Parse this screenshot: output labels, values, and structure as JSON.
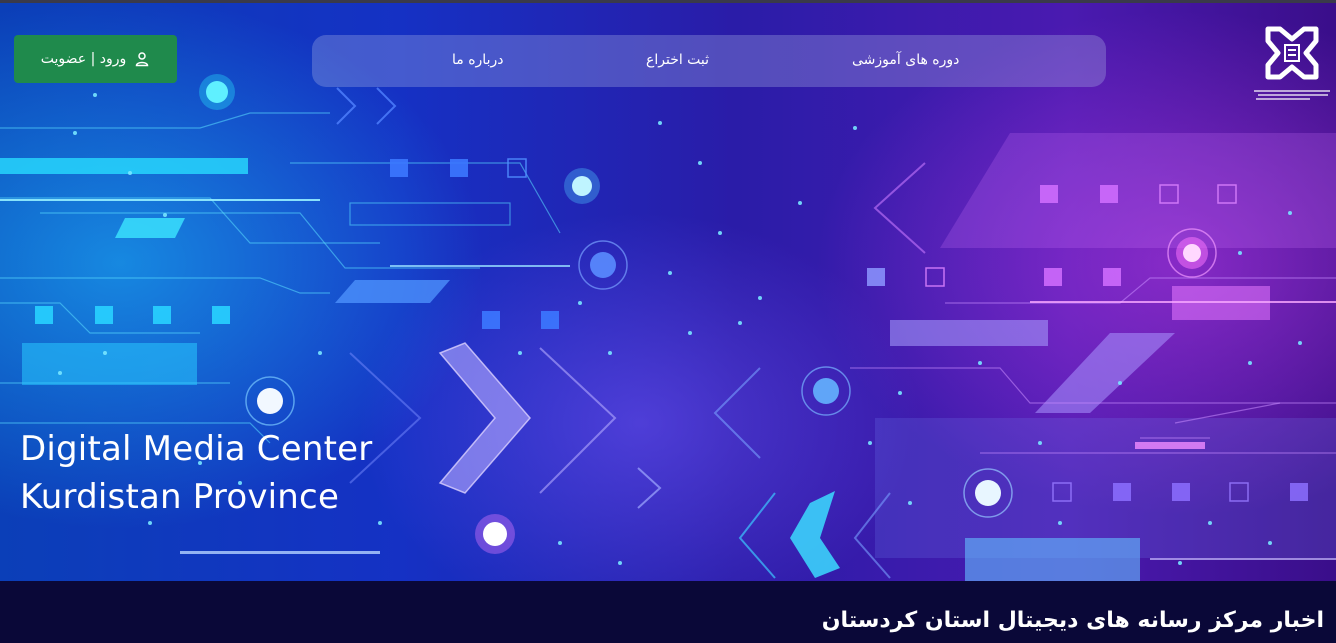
{
  "nav": {
    "items": [
      {
        "label": "دوره های آموزشی"
      },
      {
        "label": "ثبت اختراع"
      },
      {
        "label": "درباره ما"
      }
    ]
  },
  "login": {
    "label": "ورود | عضویت",
    "icon": "user-icon"
  },
  "logo": {
    "caption": "مرکز رسانه های دیجیتال استان کردستان",
    "icon": "center-logo-icon"
  },
  "hero": {
    "title_line1": "Digital Media Center",
    "title_line2": "Kurdistan Province"
  },
  "news": {
    "title": "اخبار مرکز رسانه های دیجیتال استان کردستان"
  },
  "colors": {
    "login_button": "#1f8a4c",
    "news_bar": "#0a0838",
    "nav_bg": "rgba(170,180,230,0.32)"
  }
}
